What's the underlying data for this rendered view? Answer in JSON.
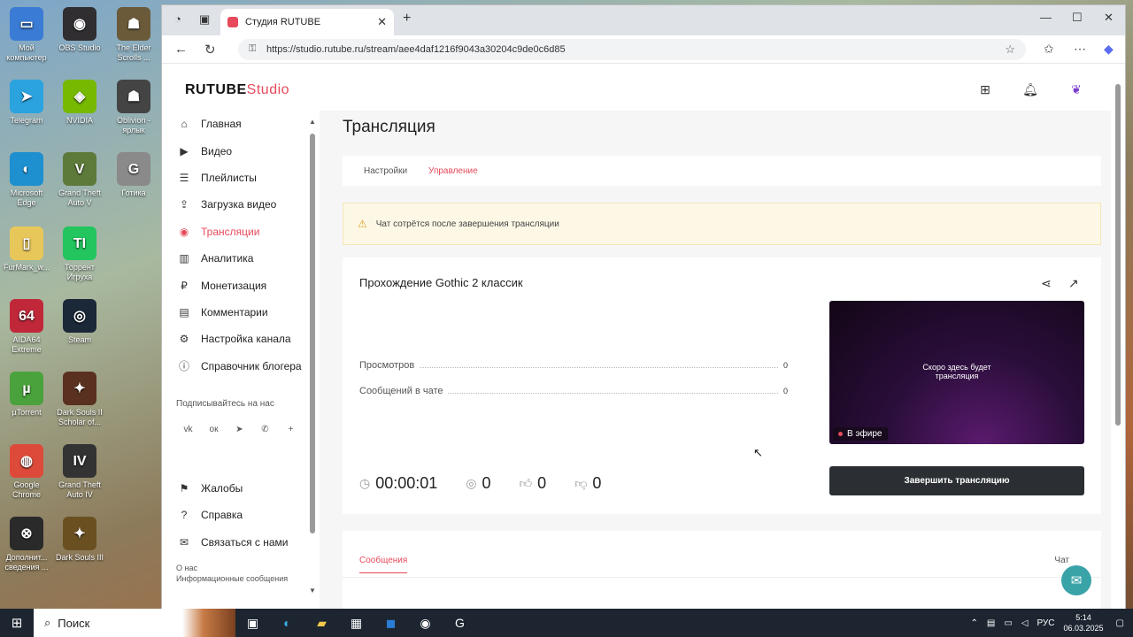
{
  "desktop": {
    "icons": [
      {
        "label": "Мой компьютер",
        "glyph": "▭",
        "color": "#3a7bd5"
      },
      {
        "label": "OBS Studio",
        "glyph": "◉",
        "color": "#302e31"
      },
      {
        "label": "The Elder Scrolls ...",
        "glyph": "☗",
        "color": "#6b5a3a"
      },
      {
        "label": "Telegram",
        "glyph": "➤",
        "color": "#2aa3df"
      },
      {
        "label": "NVIDIA",
        "glyph": "◈",
        "color": "#76b900"
      },
      {
        "label": "Oblivion - ярлык",
        "glyph": "☗",
        "color": "#444"
      },
      {
        "label": "Microsoft Edge",
        "glyph": "◐",
        "color": "#1e8fcf"
      },
      {
        "label": "Grand Theft Auto V",
        "glyph": "V",
        "color": "#5d7a3a"
      },
      {
        "label": "Готика",
        "glyph": "G",
        "color": "#8a8a8a"
      },
      {
        "label": "FurMark_w...",
        "glyph": "▯",
        "color": "#e8c75a"
      },
      {
        "label": "Торрент Игруха",
        "glyph": "TI",
        "color": "#22c55e"
      },
      {
        "label": "AIDA64 Extreme",
        "glyph": "64",
        "color": "#c0283a"
      },
      {
        "label": "Steam",
        "glyph": "◎",
        "color": "#1b2838"
      },
      {
        "label": "µTorrent",
        "glyph": "µ",
        "color": "#4aa23c"
      },
      {
        "label": "Dark Souls II Scholar of...",
        "glyph": "✦",
        "color": "#5a3020"
      },
      {
        "label": "Google Chrome",
        "glyph": "◍",
        "color": "#dd4a3a"
      },
      {
        "label": "Grand Theft Auto IV",
        "glyph": "IV",
        "color": "#333"
      },
      {
        "label": "Дополнит... сведения ...",
        "glyph": "⊗",
        "color": "#2a2a2a"
      },
      {
        "label": "Dark Souls III",
        "glyph": "✦",
        "color": "#6a5020"
      }
    ]
  },
  "browser": {
    "tab_title": "Студия RUTUBE",
    "url": "https://studio.rutube.ru/stream/aee4daf1216f9043a30204c9de0c6d85"
  },
  "logo": {
    "brand": "RUTUBE",
    "suffix": "Studio"
  },
  "sidebar": {
    "items": [
      {
        "label": "Главная",
        "icon": "home-icon",
        "glyph": "⌂"
      },
      {
        "label": "Видео",
        "icon": "video-icon",
        "glyph": "▶"
      },
      {
        "label": "Плейлисты",
        "icon": "playlist-icon",
        "glyph": "☰"
      },
      {
        "label": "Загрузка видео",
        "icon": "upload-icon",
        "glyph": "⇪"
      },
      {
        "label": "Трансляции",
        "icon": "broadcast-icon",
        "glyph": "◉"
      },
      {
        "label": "Аналитика",
        "icon": "analytics-icon",
        "glyph": "▥"
      },
      {
        "label": "Монетизация",
        "icon": "monetization-icon",
        "glyph": "₽"
      },
      {
        "label": "Комментарии",
        "icon": "comments-icon",
        "glyph": "▤"
      },
      {
        "label": "Настройка канала",
        "icon": "gear-icon",
        "glyph": "⚙"
      },
      {
        "label": "Справочник блогера",
        "icon": "info-icon",
        "glyph": "ⓘ"
      }
    ],
    "subscribe_title": "Подписывайтесь на нас",
    "socials": [
      "vk",
      "ok",
      "tg",
      "viber",
      "+"
    ],
    "bottom_items": [
      {
        "label": "Жалобы",
        "glyph": "⚑"
      },
      {
        "label": "Справка",
        "glyph": "?"
      },
      {
        "label": "Связаться с нами",
        "glyph": "✉"
      }
    ],
    "about_line1": "О нас",
    "about_line2": "Информационные сообщения"
  },
  "main": {
    "title": "Трансляция",
    "tabs": [
      "Настройки",
      "Управление"
    ],
    "active_tab": "Управление",
    "warning": "Чат сотрётся после завершения трансляции",
    "stream": {
      "name": "Прохождение Gothic 2 классик",
      "stats": [
        {
          "label": "Просмотров",
          "value": "0"
        },
        {
          "label": "Сообщений в чате",
          "value": "0"
        }
      ],
      "preview_line1": "Скоро здесь будет",
      "preview_line2": "трансляция",
      "live_label": "В эфире",
      "end_button": "Завершить трансляцию",
      "timer": "00:00:01",
      "viewers": "0",
      "likes": "0",
      "dislikes": "0"
    },
    "messages_tab": "Сообщения",
    "chat_label": "Чат"
  },
  "taskbar": {
    "search_label": "Поиск",
    "lang": "РУС",
    "time": "5:14",
    "date": "06.03.2025"
  },
  "colors": {
    "accent": "#e64a5b",
    "dark_button": "#2b2f33"
  }
}
